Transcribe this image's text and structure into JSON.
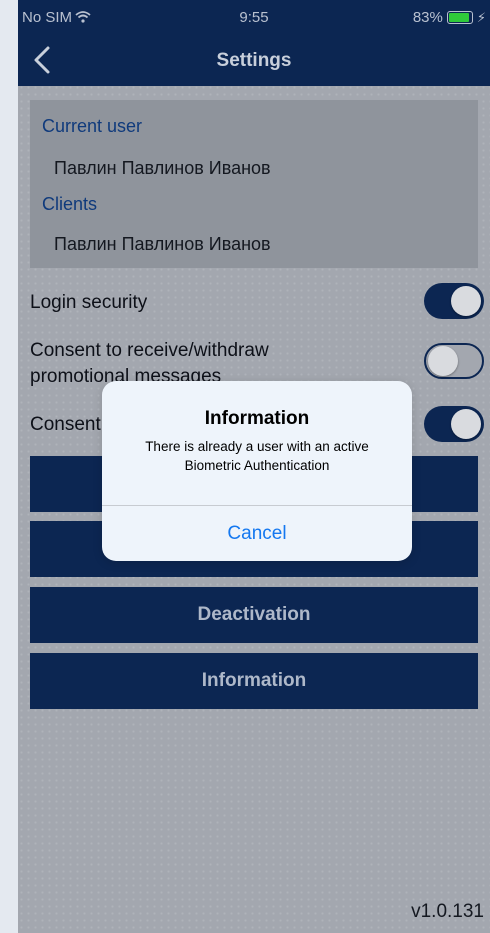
{
  "status_bar": {
    "carrier": "No SIM",
    "time": "9:55",
    "battery": "83%",
    "battery_level": 0.83
  },
  "nav": {
    "title": "Settings",
    "back_icon": "chevron-left-icon"
  },
  "user_card": {
    "current_user_label": "Current user",
    "current_user_value": "Павлин Павлинов Иванов",
    "clients_label": "Clients",
    "clients_value": "Павлин Павлинов Иванов"
  },
  "settings": [
    {
      "label": "Login security",
      "on": true
    },
    {
      "label": "Consent to receive/withdraw promotional messages",
      "on": false
    },
    {
      "label": "Consent",
      "on": true
    }
  ],
  "buttons": {
    "button_3": "Deactivation",
    "button_4": "Information"
  },
  "dialog": {
    "title": "Information",
    "message": "There is already a user with an active Biometric Authentication",
    "cancel": "Cancel"
  },
  "version": "v1.0.131",
  "colors": {
    "navy": "#0c2652",
    "link_blue": "#1478f0",
    "dialog_bg": "#eef4fb"
  }
}
